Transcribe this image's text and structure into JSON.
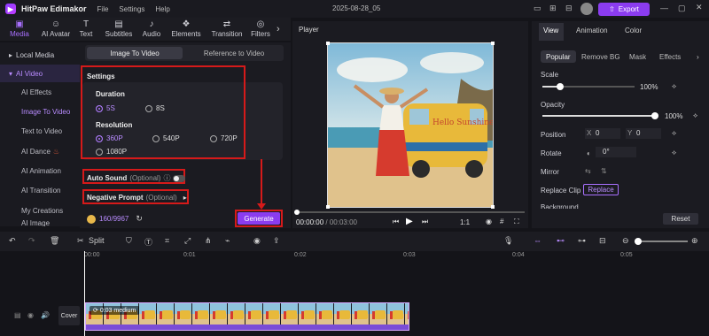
{
  "titlebar": {
    "app_name": "HitPaw Edimakor",
    "menus": [
      "File",
      "Settings",
      "Help"
    ],
    "document_title": "2025-08-28_05",
    "export_label": "Export"
  },
  "toolbar": {
    "items": [
      {
        "label": "Media",
        "icon": "media-icon"
      },
      {
        "label": "AI Avatar",
        "icon": "avatar-icon"
      },
      {
        "label": "Text",
        "icon": "text-icon"
      },
      {
        "label": "Subtitles",
        "icon": "subtitles-icon"
      },
      {
        "label": "Audio",
        "icon": "music-icon"
      },
      {
        "label": "Elements",
        "icon": "elements-icon"
      },
      {
        "label": "Transition",
        "icon": "transition-icon"
      },
      {
        "label": "Filters",
        "icon": "filters-icon"
      }
    ]
  },
  "leftnav": {
    "items": [
      "Local Media",
      "AI Video",
      "AI Effects",
      "Image To Video",
      "Text to Video",
      "AI Dance",
      "AI Animation",
      "AI Transition",
      "My Creations",
      "AI Image"
    ]
  },
  "ai_panel": {
    "tabs": [
      "Image To Video",
      "Reference to Video"
    ],
    "settings_title": "Settings",
    "duration_label": "Duration",
    "durations": [
      "5S",
      "8S"
    ],
    "resolution_label": "Resolution",
    "resolutions": [
      "360P",
      "540P",
      "720P",
      "1080P"
    ],
    "auto_sound_label": "Auto Sound",
    "auto_sound_hint": "(Optional)",
    "negative_prompt_label": "Negative Prompt",
    "negative_prompt_hint": "(Optional)",
    "credits": "160/9967",
    "generate_label": "Generate"
  },
  "player": {
    "title": "Player",
    "current_time": "00:00:00",
    "total_time": "/ 00:03:00",
    "ratio": "1:1",
    "image_text": "Hello Sunshine Everyone"
  },
  "properties": {
    "tabs": [
      "View",
      "Animation",
      "Color"
    ],
    "chips": [
      "Popular",
      "Remove BG",
      "Mask",
      "Effects"
    ],
    "scale_label": "Scale",
    "scale_value": "100%",
    "opacity_label": "Opacity",
    "opacity_value": "100%",
    "position_label": "Position",
    "pos_x_label": "X",
    "pos_x": "0",
    "pos_y_label": "Y",
    "pos_y": "0",
    "rotate_label": "Rotate",
    "rotate_value": "0°",
    "mirror_label": "Mirror",
    "replace_clip_label": "Replace Clip",
    "replace_button": "Replace",
    "background_label": "Background",
    "reset_label": "Reset"
  },
  "timeline": {
    "split_label": "Split",
    "ruler": [
      "00:00",
      "0:01",
      "0:02",
      "0:03",
      "0:04",
      "0:05"
    ],
    "cover_label": "Cover",
    "clip_label": "0:03 medium"
  }
}
